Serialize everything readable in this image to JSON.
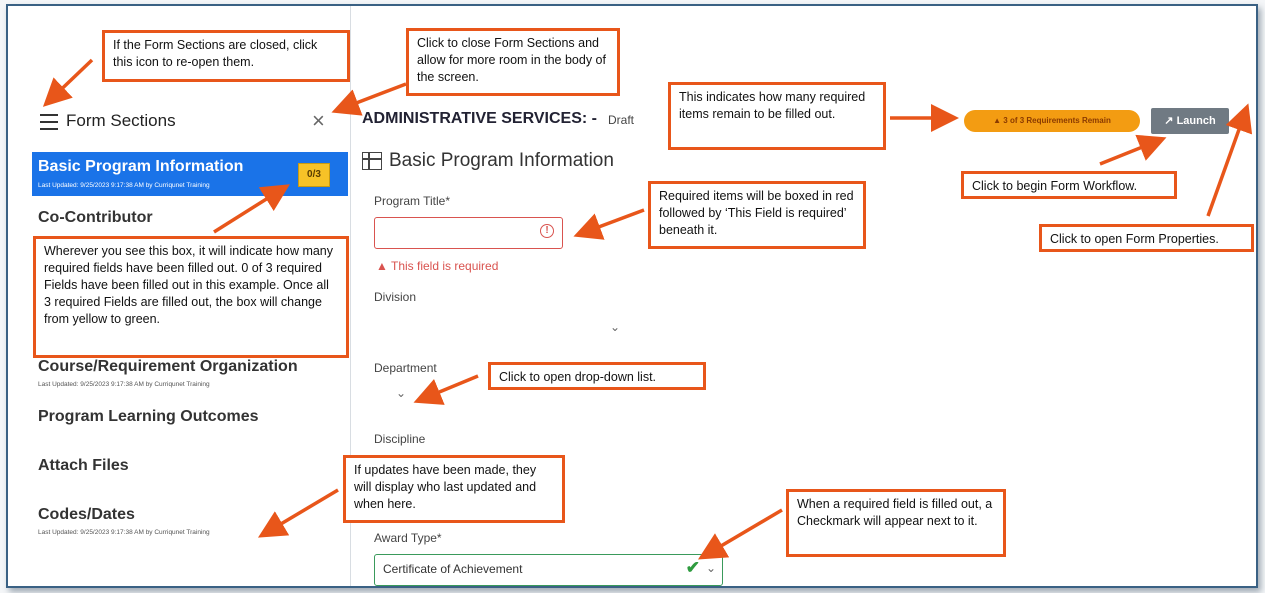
{
  "sidebar": {
    "title": "Form Sections",
    "close_icon": "×",
    "active_section": {
      "label": "Basic Program Information",
      "updated": "Last Updated: 9/25/2023 9:17:38 AM by Curriqunet Training",
      "count": "0/3"
    },
    "sections": [
      {
        "label": "Co-Contributor",
        "updated": ""
      },
      {
        "label": "Course/Requirement Organization",
        "updated": "Last Updated: 9/25/2023 9:17:38 AM by Curriqunet Training"
      },
      {
        "label": "Program Learning Outcomes",
        "updated": ""
      },
      {
        "label": "Attach Files",
        "updated": ""
      },
      {
        "label": "Codes/Dates",
        "updated": "Last Updated: 9/25/2023 9:17:38 AM by Curriqunet Training"
      }
    ]
  },
  "header": {
    "title": "ADMINISTRATIVE SERVICES: -",
    "status": "Draft",
    "requirements": "3 of 3 Requirements Remain",
    "launch_label": "Launch",
    "launch_icon": "↗"
  },
  "form": {
    "section_title": "Basic Program Information",
    "fields": {
      "program_title_label": "Program Title*",
      "program_title_error": "This field is required",
      "division_label": "Division",
      "department_label": "Department",
      "discipline_label": "Discipline",
      "award_type_label": "Award Type*",
      "award_type_value": "Certificate of Achievement"
    }
  },
  "callouts": {
    "reopen": "If the Form Sections are closed, click this icon to re-open them.",
    "close": "Click to close Form Sections and allow for more  room in the body of the screen.",
    "remain": "This indicates how many required items remain to  be filled out.",
    "workflow": "Click to begin Form Workflow.",
    "properties": "Click to open Form Properties.",
    "required": "Required items will be boxed in red followed by ‘This Field is required’ beneath it.",
    "box": "Wherever you see this box,  it will indicate how many required fields have been filled out. 0 of 3 required Fields have been filled out in this example. Once all 3 required Fields are filled out, the box will change from yellow to green.",
    "dropdown": "Click to open drop-down list.",
    "updates": "If updates have been made, they will display  who last updated and when here.",
    "checkmark": "When a required field is filled out, a Checkmark will appear next to it."
  },
  "colors": {
    "accent": "#1a73e8",
    "callout_border": "#e8561a",
    "error": "#d9534f",
    "success": "#2e9b3f",
    "requirements_pill": "#f39c12",
    "count_box": "#f7c227"
  },
  "icons": [
    "hamburger-icon",
    "close-icon",
    "table-icon",
    "error-circle-icon",
    "warning-icon",
    "chevron-down-icon",
    "checkmark-icon",
    "external-link-icon",
    "sliders-icon"
  ]
}
